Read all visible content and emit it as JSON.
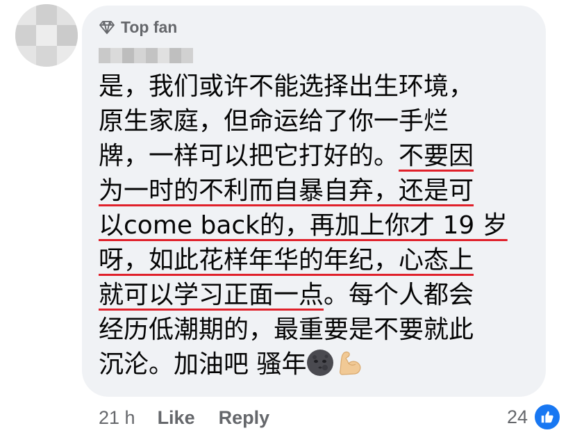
{
  "comment": {
    "badge": "Top fan",
    "lines": [
      {
        "parts": [
          "是，我们或许不能选择出生环境，"
        ],
        "hl": [
          false
        ]
      },
      {
        "parts": [
          "原生家庭，但命运给了你一手烂"
        ],
        "hl": [
          false
        ]
      },
      {
        "parts": [
          "牌，一样可以把它打好的。",
          "不要因"
        ],
        "hl": [
          false,
          true
        ]
      },
      {
        "parts": [
          "为一时的不利而自暴自弃，还是可"
        ],
        "hl": [
          true
        ]
      },
      {
        "parts": [
          "以come back的，再加上你才 19 岁"
        ],
        "hl": [
          true
        ]
      },
      {
        "parts": [
          "呀，如此花样年华的年纪，心态上"
        ],
        "hl": [
          true
        ]
      },
      {
        "parts": [
          "就可以学习正面一点",
          "。每个人都会"
        ],
        "hl": [
          true,
          false
        ]
      },
      {
        "parts": [
          "经历低潮期的，最重要是不要就此"
        ],
        "hl": [
          false
        ]
      },
      {
        "parts": [
          "沉沦。加油吧 骚年"
        ],
        "hl": [
          false
        ]
      }
    ],
    "emojis": [
      "new-moon-face-icon",
      "flexed-biceps-icon"
    ],
    "highlight_color": "#e0202a"
  },
  "footer": {
    "time": "21 h",
    "like_label": "Like",
    "reply_label": "Reply",
    "reaction_count": "24"
  },
  "colors": {
    "bubble": "#f0f2f5",
    "meta_text": "#65676b",
    "like_blue": "#1877f2"
  }
}
